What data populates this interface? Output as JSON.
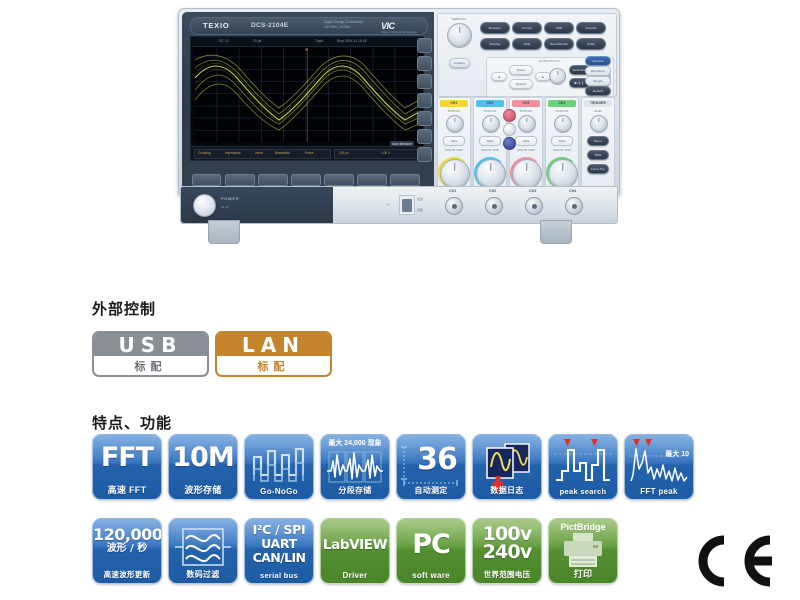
{
  "product": {
    "brand": "TEXIO",
    "model": "DCS-2104E",
    "subtitle_line1": "Digital Storage Oscilloscope",
    "subtitle_line2": "100 MHz  |  1GSa/s",
    "logo": "VIC",
    "logo_sub": "Vision In Network Technologies",
    "power_label": "POWER",
    "power_sub": "●1  ●2",
    "usb_label_top": "在出",
    "usb_label_bottom": "存取",
    "bnc_labels": [
      "CH1",
      "CH2",
      "CH3",
      "CH4"
    ],
    "screen": {
      "status_left": "DC  1X",
      "status_mid": "20 μs",
      "status_trig": "Trig'd",
      "status_right": "Stop   2014 11 16 15",
      "bottom_left_items": [
        "Coupling",
        "Impedance",
        "Invert",
        "Bandwidth",
        "Probe"
      ],
      "bottom_right_items": [
        "100 μs",
        "1.00 V"
      ],
      "badge": "Auto Measure"
    },
    "control_panel": {
      "vertical_label": "VERTICAL",
      "horizontal_label": "HORIZONTAL",
      "position_label": "POSITION",
      "volts_div_label": "VOLTS / DIV",
      "time_div_label": "TIME / DIV",
      "level_label": "LEVEL",
      "acquire_label": "Acquire",
      "menu_buttons_row1": [
        "Measure",
        "Cursor",
        "APP",
        "Acquire"
      ],
      "menu_buttons_row2": [
        "Display",
        "Help",
        "Save/Recall",
        "Utility"
      ],
      "right_buttons": [
        "Autoset",
        "Run/Stop",
        "Single",
        "Default"
      ],
      "horizontal_buttons": [
        "Zoom",
        "Search",
        "Set/Clear",
        "Play/Pause"
      ],
      "trigger_buttons": [
        "Menu",
        "50%",
        "Force-Trig"
      ],
      "channels": [
        {
          "name": "CH1",
          "color": "#f2d83c",
          "button": "CH1"
        },
        {
          "name": "CH2",
          "color": "#4ec3e8",
          "button": "CH2"
        },
        {
          "name": "CH3",
          "color": "#f2909f",
          "button": "CH3"
        },
        {
          "name": "CH4",
          "color": "#6fcf7a",
          "button": "CH4"
        }
      ],
      "trigger_name": "TRIGGER",
      "math_buttons": [
        "MATH",
        "REF",
        "BUS"
      ]
    }
  },
  "external_control": {
    "heading": "外部控制",
    "badges": [
      {
        "name": "USB",
        "sub": "标配",
        "color": "#8a8f96"
      },
      {
        "name": "LAN",
        "sub": "标配",
        "color": "#c5832c"
      }
    ]
  },
  "features": {
    "heading": "特点、功能",
    "row1": [
      {
        "id": "fft",
        "style": "blue",
        "big": "FFT",
        "caption": "高速 FFT",
        "icon": "fft-text-icon"
      },
      {
        "id": "memory",
        "style": "blue",
        "big": "10M",
        "caption": "波形存储",
        "icon": "memory-text-icon"
      },
      {
        "id": "gonogo",
        "style": "blue",
        "big": "",
        "caption": "Go-NoGo",
        "icon": "square-wave-icon"
      },
      {
        "id": "segment",
        "style": "blue",
        "big": "",
        "toptag": "最大 24,000 现象",
        "caption": "分段存储",
        "icon": "segmented-wave-icon"
      },
      {
        "id": "automeasure",
        "style": "blue",
        "big": "36",
        "caption": "自动测定",
        "icon": "auto-measure-icon"
      },
      {
        "id": "datalog",
        "style": "blue",
        "big": "",
        "caption": "数据日志",
        "icon": "data-log-icon"
      },
      {
        "id": "peaksearch",
        "style": "blue",
        "big": "",
        "caption": "peak search",
        "icon": "peak-search-icon"
      },
      {
        "id": "fftpeak",
        "style": "blue",
        "big": "",
        "midtag": "最大 10",
        "caption": "FFT peak",
        "icon": "fft-peak-icon"
      }
    ],
    "row2": [
      {
        "id": "waverate",
        "style": "blue",
        "big": "120,000",
        "big2": "波形 / 秒",
        "caption": "高速波形更新",
        "icon": "waveform-rate-icon"
      },
      {
        "id": "digitalfilter",
        "style": "blue",
        "big": "",
        "caption": "数码过滤",
        "icon": "digital-filter-icon"
      },
      {
        "id": "serialbus",
        "style": "blue",
        "big": "I²C / SPI",
        "big2": "UART",
        "big3": "CAN/LIN",
        "caption": "serial bus",
        "icon": "serial-bus-icon"
      },
      {
        "id": "labview",
        "style": "green",
        "big": "LabVIEW",
        "caption": "Driver",
        "icon": "labview-icon"
      },
      {
        "id": "pc",
        "style": "green",
        "big": "PC",
        "caption": "soft ware",
        "icon": "pc-software-icon"
      },
      {
        "id": "voltage",
        "style": "green",
        "big": "100v",
        "big2": "240v",
        "caption": "世界范围电压",
        "icon": "voltage-icon"
      },
      {
        "id": "pictbridge",
        "style": "green",
        "big": "",
        "toptag": "PictBridge",
        "caption": "打印",
        "icon": "printer-icon"
      }
    ],
    "ce_mark": "CE"
  }
}
